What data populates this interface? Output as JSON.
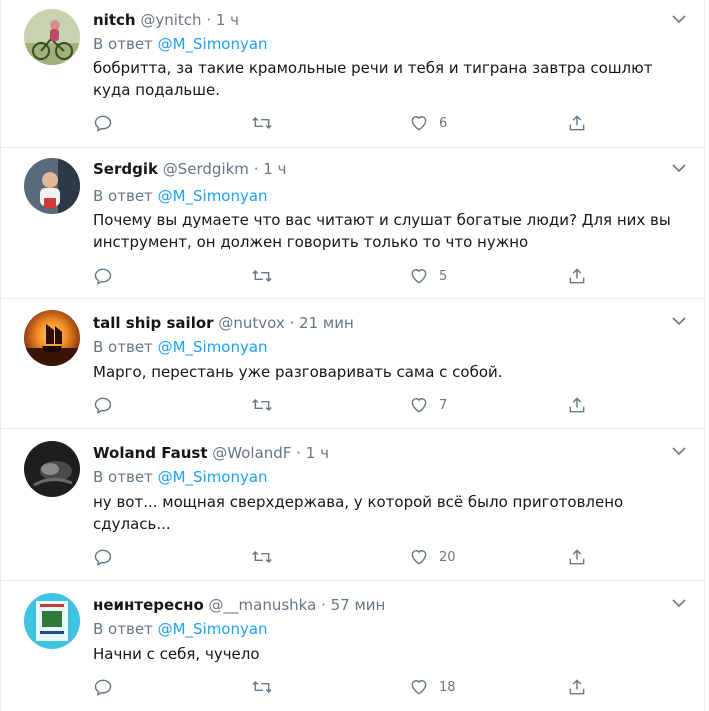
{
  "reply_prefix": "В ответ",
  "tweets": [
    {
      "name": "nitch",
      "handle": "@ynitch",
      "time": "1 ч",
      "reply_to": "@M_Simonyan",
      "text": "бобритта, за такие крамольные речи и тебя и тиграна завтра сошлют куда подальше.",
      "likes": "6",
      "avatar": "cyclist-avatar"
    },
    {
      "name": "Serdgik",
      "handle": "@Serdgikm",
      "time": "1 ч",
      "reply_to": "@M_Simonyan",
      "text": "Почему вы думаете что вас читают и слушат богатые люди? Для них вы инструмент,  он должен говорить только то что нужно",
      "likes": "5",
      "avatar": "child-avatar"
    },
    {
      "name": "tall ship sailor",
      "handle": "@nutvox",
      "time": "21 мин",
      "reply_to": "@M_Simonyan",
      "text": "Марго, перестань уже разговаривать сама с собой.",
      "likes": "7",
      "avatar": "sailing-ship-avatar"
    },
    {
      "name": "Woland Faust",
      "handle": "@WolandF",
      "time": "1 ч",
      "reply_to": "@M_Simonyan",
      "text": "ну вот... мощная сверхдержава, у которой всё было приготовлено сдулась...",
      "likes": "20",
      "avatar": "dark-avatar"
    },
    {
      "name": "неинтересно",
      "handle": "@__manushka",
      "time": "57 мин",
      "reply_to": "@M_Simonyan",
      "text": "Начни с себя, чучело",
      "likes": "18",
      "avatar": "book-cover-avatar"
    }
  ],
  "colors": {
    "accent": "#1da1f2",
    "secondary_text": "#657786",
    "primary_text": "#14171a",
    "divider": "#e6ecf0"
  },
  "icons": [
    "reply-icon",
    "retweet-icon",
    "like-icon",
    "share-icon",
    "chevron-down-icon"
  ]
}
